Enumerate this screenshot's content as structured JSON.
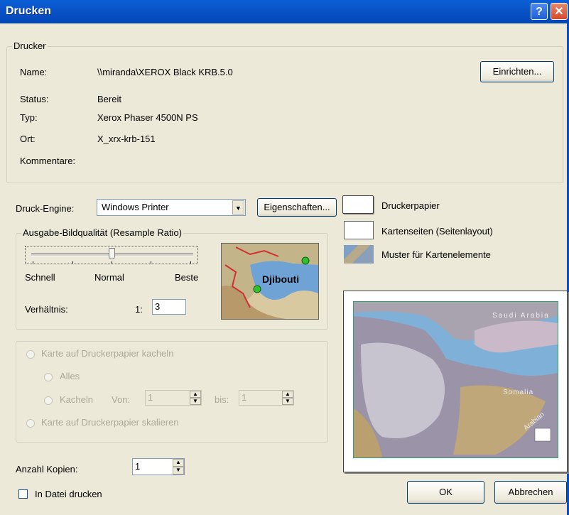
{
  "window": {
    "title": "Drucken",
    "help_label": "?",
    "close_label": "✕"
  },
  "printer": {
    "group_label": "Drucker",
    "name_label": "Name:",
    "name_value": "\\\\miranda\\XEROX Black KRB.5.0",
    "status_label": "Status:",
    "status_value": "Bereit",
    "type_label": "Typ:",
    "type_value": "Xerox Phaser 4500N PS",
    "location_label": "Ort:",
    "location_value": "X_xrx-krb-151",
    "comment_label": "Kommentare:",
    "comment_value": "",
    "setup_button": "Einrichten..."
  },
  "engine": {
    "label": "Druck-Engine:",
    "selected": "Windows Printer",
    "properties_button": "Eigenschaften..."
  },
  "legend": {
    "printer_paper": "Druckerpapier",
    "map_pages": "Kartenseiten (Seitenlayout)",
    "map_element_sample": "Muster für Kartenelemente"
  },
  "quality": {
    "group_label": "Ausgabe-Bildqualität (Resample Ratio)",
    "slider_value": 0.5,
    "fast": "Schnell",
    "normal": "Normal",
    "best": "Beste",
    "ratio_label": "Verhältnis:",
    "ratio_prefix": "1:",
    "ratio_value": "3",
    "sample_label": "Djibouti"
  },
  "tiling": {
    "tile_option": "Karte auf Druckerpapier kacheln",
    "all_option": "Alles",
    "tiles_option": "Kacheln",
    "from_label": "Von:",
    "from_value": "1",
    "to_label": "bis:",
    "to_value": "1",
    "scale_option": "Karte auf Druckerpapier skalieren"
  },
  "preview": {
    "label_saudi": "Saudi Arabia",
    "label_somalia": "Somalia",
    "label_arabian": "Arabian"
  },
  "copies": {
    "label": "Anzahl Kopien:",
    "value": "1"
  },
  "print_to_file": {
    "label": "In Datei drucken",
    "checked": false
  },
  "buttons": {
    "ok": "OK",
    "cancel": "Abbrechen"
  },
  "colors": {
    "title_bar": "#0a54c8",
    "dialog_bg": "#ece9d8",
    "preview_sea": "#4a8cc2"
  }
}
